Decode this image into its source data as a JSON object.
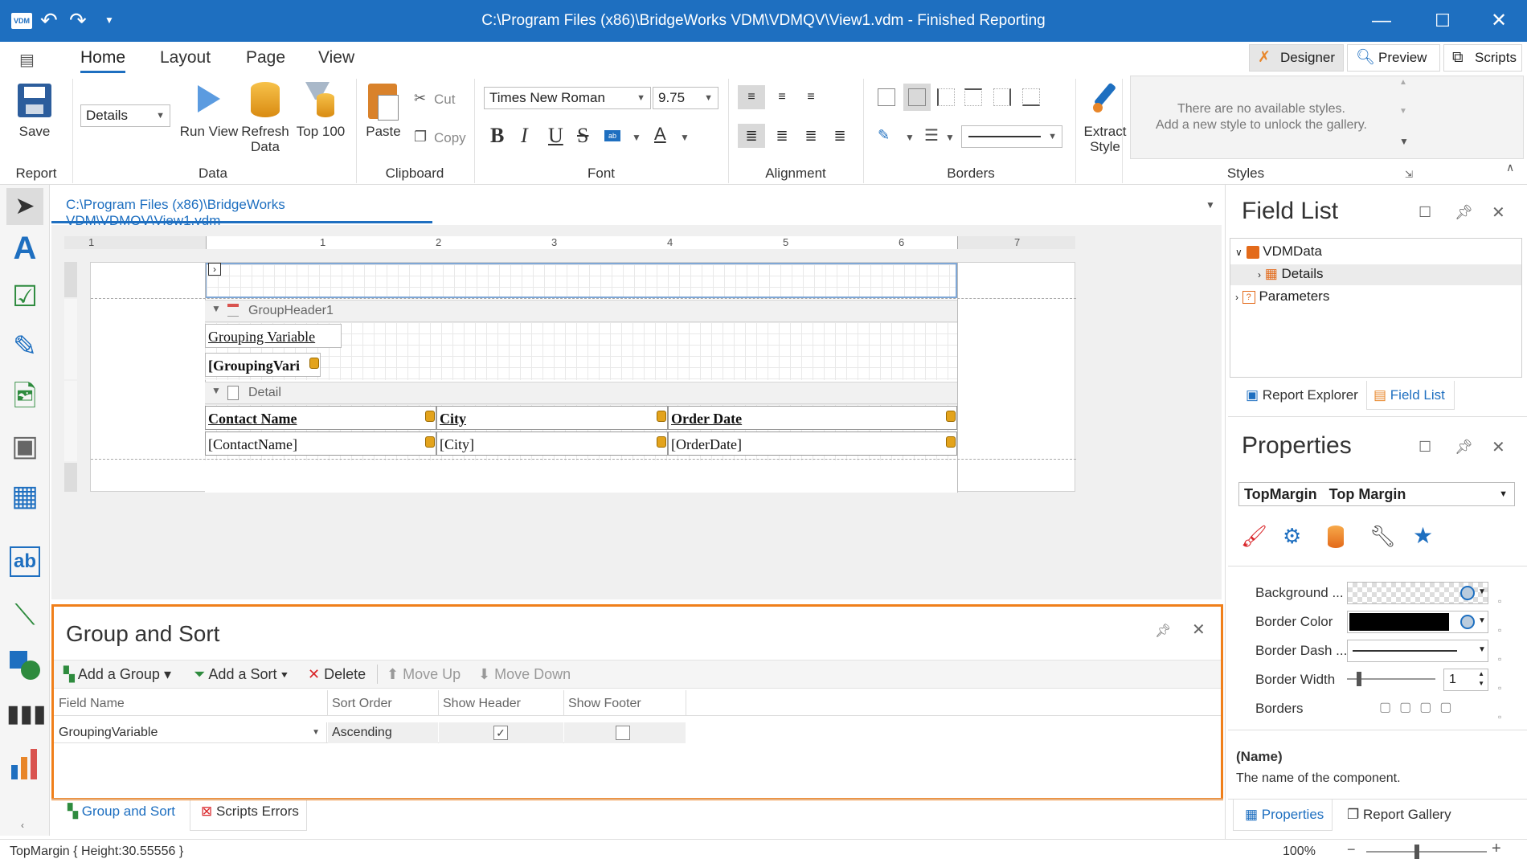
{
  "window": {
    "title": "C:\\Program Files (x86)\\BridgeWorks VDM\\VDMQV\\View1.vdm - Finished Reporting",
    "app_badge": "VDM"
  },
  "ribbon_tabs": [
    "Home",
    "Layout",
    "Page",
    "View"
  ],
  "modes": {
    "designer": "Designer",
    "preview": "Preview",
    "scripts": "Scripts"
  },
  "ribbon": {
    "report": {
      "save": "Save",
      "group": "Report"
    },
    "data": {
      "combo": "Details",
      "run_view": "Run View",
      "refresh_1": "Refresh",
      "refresh_2": "Data",
      "top100": "Top 100",
      "group": "Data"
    },
    "clipboard": {
      "paste": "Paste",
      "cut": "Cut",
      "copy": "Copy",
      "group": "Clipboard"
    },
    "font": {
      "family": "Times New Roman",
      "size": "9.75",
      "group": "Font"
    },
    "alignment": {
      "group": "Alignment"
    },
    "borders": {
      "group": "Borders"
    },
    "extract": {
      "line1": "Extract",
      "line2": "Style"
    },
    "styles": {
      "msg1": "There are no available styles.",
      "msg2": "Add a new style to unlock the gallery.",
      "group": "Styles"
    }
  },
  "document": {
    "tab": "C:\\Program Files (x86)\\BridgeWorks VDM\\VDMQV\\View1.vdm",
    "ruler_marks": [
      "1",
      "1",
      "2",
      "3",
      "4",
      "5",
      "6",
      "7"
    ],
    "group_header_band": "GroupHeader1",
    "grouping_label": "Grouping Variable",
    "grouping_field": "[GroupingVari",
    "detail_band": "Detail",
    "headers": [
      "Contact Name",
      "City",
      "Order Date"
    ],
    "fields": [
      "[ContactName]",
      "[City]",
      "[OrderDate]"
    ]
  },
  "group_sort": {
    "title": "Group and Sort",
    "tools": {
      "add_group": "Add a Group",
      "add_sort": "Add a Sort",
      "delete": "Delete",
      "move_up": "Move Up",
      "move_down": "Move Down"
    },
    "columns": [
      "Field Name",
      "Sort Order",
      "Show Header",
      "Show Footer"
    ],
    "row": {
      "field": "GroupingVariable",
      "order": "Ascending",
      "show_header": true,
      "show_footer": false
    }
  },
  "bottom_tabs": {
    "group_sort": "Group and Sort",
    "scripts_errors": "Scripts Errors"
  },
  "field_list": {
    "title": "Field List",
    "items": [
      "VDMData",
      "Details",
      "Parameters"
    ],
    "tabs": {
      "explorer": "Report Explorer",
      "field_list": "Field List"
    }
  },
  "properties": {
    "title": "Properties",
    "selector": {
      "name": "TopMargin",
      "type": "Top Margin"
    },
    "rows": [
      "Background ...",
      "Border Color",
      "Border Dash ...",
      "Border Width",
      "Borders"
    ],
    "border_width": "1",
    "desc_name": "(Name)",
    "desc_text": "The name of the component.",
    "tabs": {
      "properties": "Properties",
      "gallery": "Report Gallery"
    }
  },
  "status": {
    "left": "TopMargin { Height:30.55556 }",
    "zoom": "100%"
  },
  "colors": {
    "accent": "#1e6fc0",
    "highlight": "#f07f1a"
  }
}
